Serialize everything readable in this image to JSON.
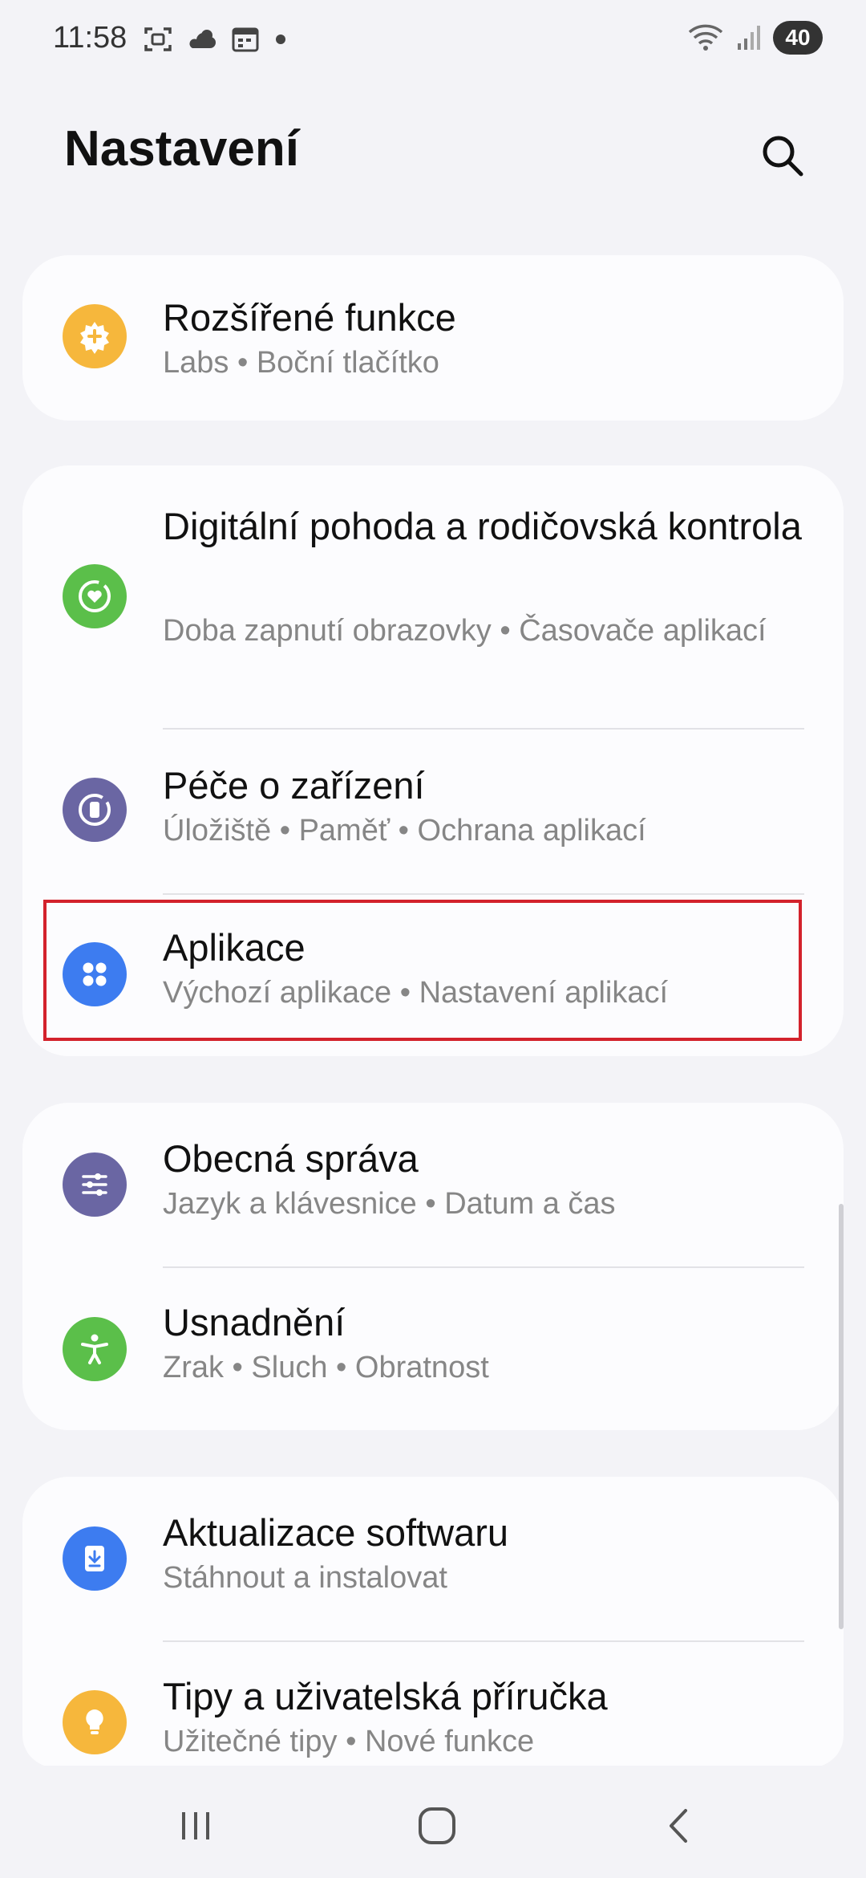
{
  "status": {
    "time": "11:58",
    "battery": "40"
  },
  "header": {
    "title": "Nastavení"
  },
  "groups": [
    {
      "items": [
        {
          "title": "Rozšířené funkce",
          "subtitle": "Labs  •  Boční tlačítko",
          "icon": "advanced-features-icon",
          "color": "#f6b73c"
        }
      ]
    },
    {
      "items": [
        {
          "title": "Digitální pohoda a rodičovská kontrola",
          "subtitle": "Doba zapnutí obrazovky  •  Časovače aplikací",
          "icon": "digital-wellbeing-icon",
          "color": "#5bbf4a"
        },
        {
          "title": "Péče o zařízení",
          "subtitle": "Úložiště  •  Paměť  •  Ochrana aplikací",
          "icon": "device-care-icon",
          "color": "#6a66a3"
        },
        {
          "title": "Aplikace",
          "subtitle": "Výchozí aplikace  •  Nastavení aplikací",
          "icon": "apps-icon",
          "color": "#3d7cf0"
        }
      ]
    },
    {
      "items": [
        {
          "title": "Obecná správa",
          "subtitle": "Jazyk a klávesnice  •  Datum a čas",
          "icon": "general-management-icon",
          "color": "#6a66a3"
        },
        {
          "title": "Usnadnění",
          "subtitle": "Zrak  •  Sluch  •  Obratnost",
          "icon": "accessibility-icon",
          "color": "#5bbf4a"
        }
      ]
    },
    {
      "items": [
        {
          "title": "Aktualizace softwaru",
          "subtitle": "Stáhnout a instalovat",
          "icon": "software-update-icon",
          "color": "#3d7cf0"
        },
        {
          "title": "Tipy a uživatelská příručka",
          "subtitle": "Užitečné tipy  •  Nové funkce",
          "icon": "tips-icon",
          "color": "#f6b73c"
        }
      ]
    }
  ]
}
